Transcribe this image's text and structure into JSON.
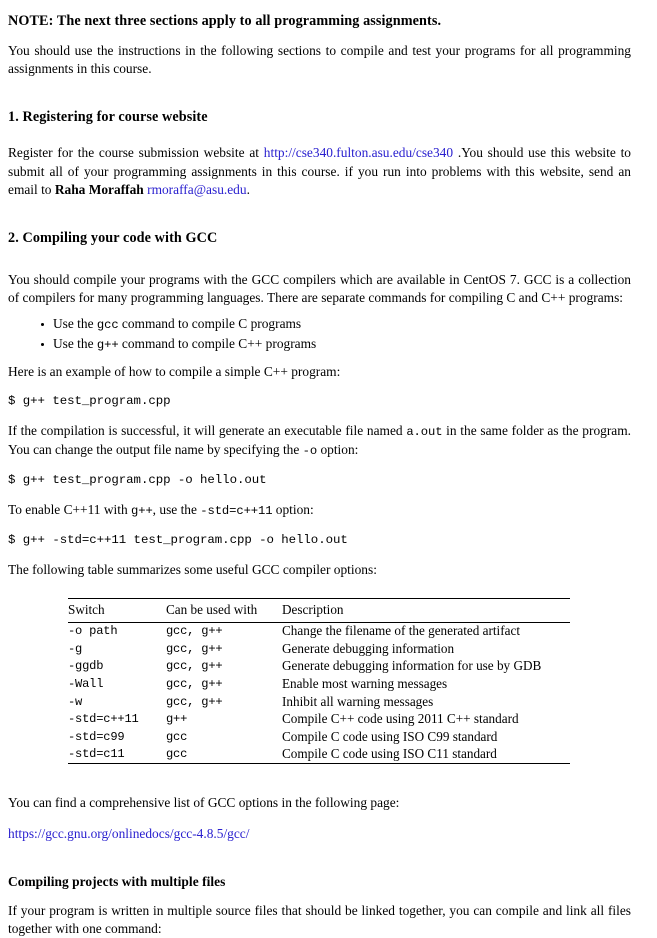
{
  "document": {
    "note": {
      "label": "NOTE:",
      "text": "The next three sections apply to all programming assignments.",
      "full": "NOTE: The next three sections apply to all programming assignments."
    },
    "intro_paragraph": "You should use the instructions in the following sections to compile and test your programs for all programming assignments in this course.",
    "sections": [
      {
        "number": "1.",
        "title": "Registering for course website",
        "heading_full": "1.  Registering for course website",
        "paragraph_before_link": "Register for the course submission website at ",
        "website_link": "http://cse340.fulton.asu.edu/cse340",
        "paragraph_after_link": " .You should use this website to submit all of your programming assignments in this course. if you run into problems with this website, send an email to ",
        "contact_name": "Raha Moraffah",
        "contact_email": "rmoraffa@asu.edu",
        "paragraph_end": "."
      },
      {
        "number": "2.",
        "title": "Compiling your code with GCC",
        "heading_full": "2.  Compiling your code with GCC",
        "paragraph_1_part_a": "You should compile your programs with the GCC compilers which are available in CentOS 7. GCC is a collection of compilers for many programming languages. There are separate commands for compiling C and C++ programs:",
        "bullets": [
          {
            "pre": "Use the ",
            "code": "gcc",
            "post": " command to compile C programs"
          },
          {
            "pre": "Use the ",
            "code": "g++",
            "post": " command to compile C++ programs"
          }
        ],
        "example_intro": "Here is an example of how to compile a simple C++ program:",
        "code_1": "$ g++ test_program.cpp",
        "paragraph_2_part_a": "If the compilation is successful, it will generate an executable file named ",
        "paragraph_2_code_1": "a.out",
        "paragraph_2_part_b": " in the same folder as the program. You can change the output file name by specifying the ",
        "paragraph_2_code_2": "-o",
        "paragraph_2_part_c": " option:",
        "code_2": "$ g++ test_program.cpp -o hello.out",
        "paragraph_3_part_a": "To enable C++11 with ",
        "paragraph_3_code_1": "g++",
        "paragraph_3_part_b": ", use the ",
        "paragraph_3_code_2": "-std=c++11",
        "paragraph_3_part_c": " option:",
        "code_3": "$ g++ -std=c++11 test_program.cpp -o hello.out",
        "table_intro": "The following table summarizes some useful GCC compiler options:",
        "closing_paragraph": "You can find a comprehensive list of GCC options in the following page:",
        "docs_link": "https://gcc.gnu.org/onlinedocs/gcc-4.8.5/gcc/"
      }
    ],
    "options_table": {
      "headers": [
        "Switch",
        "Can be used with",
        "Description"
      ],
      "rows": [
        [
          "-o path",
          "gcc, g++",
          "Change the filename of the generated artifact"
        ],
        [
          "-g",
          "gcc, g++",
          "Generate debugging information"
        ],
        [
          "-ggdb",
          "gcc, g++",
          "Generate debugging information for use by GDB"
        ],
        [
          "-Wall",
          "gcc, g++",
          "Enable most warning messages"
        ],
        [
          "-w",
          "gcc, g++",
          "Inhibit all warning messages"
        ],
        [
          "-std=c++11",
          "g++",
          "Compile C++ code using 2011 C++ standard"
        ],
        [
          "-std=c99",
          "gcc",
          "Compile C code using ISO C99 standard"
        ],
        [
          "-std=c11",
          "gcc",
          "Compile C code using ISO C11 standard"
        ]
      ]
    },
    "subsection": {
      "title": "Compiling projects with multiple files",
      "paragraph": "If your program is written in multiple source files that should be linked together, you can compile and link all files together with one command:"
    },
    "colors": {
      "link": "#2a20cf",
      "text": "#000000",
      "background": "#ffffff"
    }
  }
}
